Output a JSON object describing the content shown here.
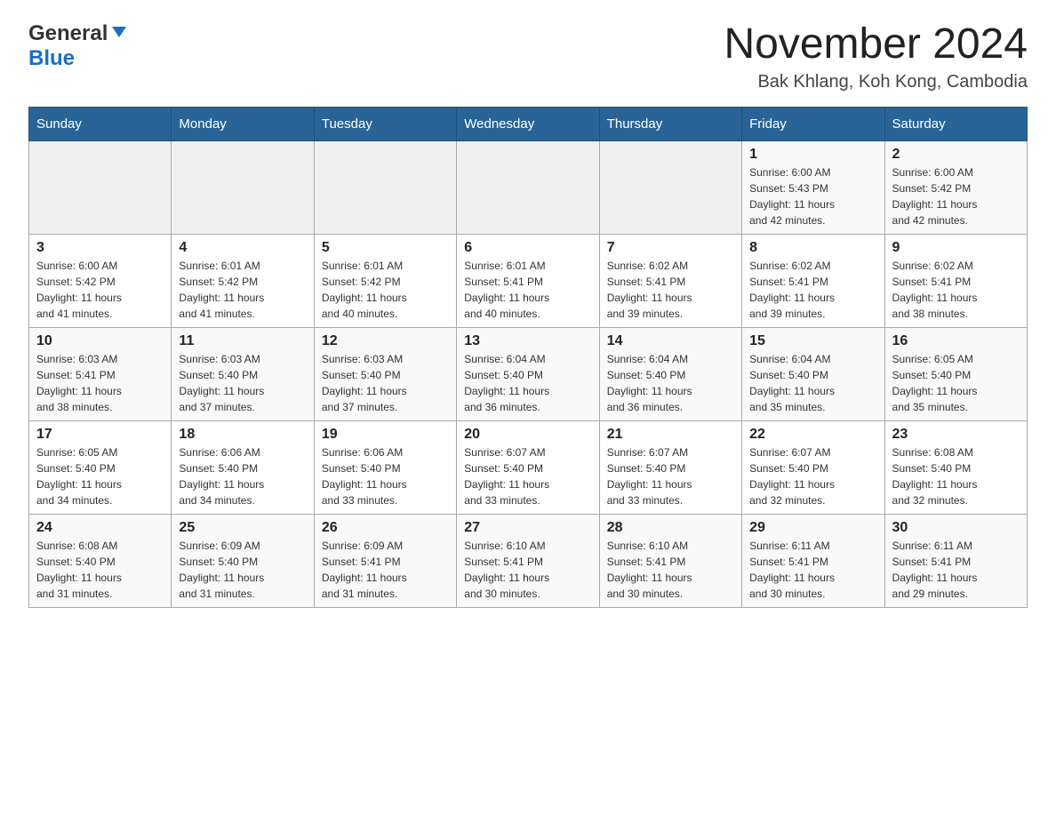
{
  "header": {
    "logo_general": "General",
    "logo_blue": "Blue",
    "month_title": "November 2024",
    "location": "Bak Khlang, Koh Kong, Cambodia"
  },
  "days_of_week": [
    "Sunday",
    "Monday",
    "Tuesday",
    "Wednesday",
    "Thursday",
    "Friday",
    "Saturday"
  ],
  "weeks": [
    [
      {
        "day": "",
        "info": ""
      },
      {
        "day": "",
        "info": ""
      },
      {
        "day": "",
        "info": ""
      },
      {
        "day": "",
        "info": ""
      },
      {
        "day": "",
        "info": ""
      },
      {
        "day": "1",
        "info": "Sunrise: 6:00 AM\nSunset: 5:43 PM\nDaylight: 11 hours\nand 42 minutes."
      },
      {
        "day": "2",
        "info": "Sunrise: 6:00 AM\nSunset: 5:42 PM\nDaylight: 11 hours\nand 42 minutes."
      }
    ],
    [
      {
        "day": "3",
        "info": "Sunrise: 6:00 AM\nSunset: 5:42 PM\nDaylight: 11 hours\nand 41 minutes."
      },
      {
        "day": "4",
        "info": "Sunrise: 6:01 AM\nSunset: 5:42 PM\nDaylight: 11 hours\nand 41 minutes."
      },
      {
        "day": "5",
        "info": "Sunrise: 6:01 AM\nSunset: 5:42 PM\nDaylight: 11 hours\nand 40 minutes."
      },
      {
        "day": "6",
        "info": "Sunrise: 6:01 AM\nSunset: 5:41 PM\nDaylight: 11 hours\nand 40 minutes."
      },
      {
        "day": "7",
        "info": "Sunrise: 6:02 AM\nSunset: 5:41 PM\nDaylight: 11 hours\nand 39 minutes."
      },
      {
        "day": "8",
        "info": "Sunrise: 6:02 AM\nSunset: 5:41 PM\nDaylight: 11 hours\nand 39 minutes."
      },
      {
        "day": "9",
        "info": "Sunrise: 6:02 AM\nSunset: 5:41 PM\nDaylight: 11 hours\nand 38 minutes."
      }
    ],
    [
      {
        "day": "10",
        "info": "Sunrise: 6:03 AM\nSunset: 5:41 PM\nDaylight: 11 hours\nand 38 minutes."
      },
      {
        "day": "11",
        "info": "Sunrise: 6:03 AM\nSunset: 5:40 PM\nDaylight: 11 hours\nand 37 minutes."
      },
      {
        "day": "12",
        "info": "Sunrise: 6:03 AM\nSunset: 5:40 PM\nDaylight: 11 hours\nand 37 minutes."
      },
      {
        "day": "13",
        "info": "Sunrise: 6:04 AM\nSunset: 5:40 PM\nDaylight: 11 hours\nand 36 minutes."
      },
      {
        "day": "14",
        "info": "Sunrise: 6:04 AM\nSunset: 5:40 PM\nDaylight: 11 hours\nand 36 minutes."
      },
      {
        "day": "15",
        "info": "Sunrise: 6:04 AM\nSunset: 5:40 PM\nDaylight: 11 hours\nand 35 minutes."
      },
      {
        "day": "16",
        "info": "Sunrise: 6:05 AM\nSunset: 5:40 PM\nDaylight: 11 hours\nand 35 minutes."
      }
    ],
    [
      {
        "day": "17",
        "info": "Sunrise: 6:05 AM\nSunset: 5:40 PM\nDaylight: 11 hours\nand 34 minutes."
      },
      {
        "day": "18",
        "info": "Sunrise: 6:06 AM\nSunset: 5:40 PM\nDaylight: 11 hours\nand 34 minutes."
      },
      {
        "day": "19",
        "info": "Sunrise: 6:06 AM\nSunset: 5:40 PM\nDaylight: 11 hours\nand 33 minutes."
      },
      {
        "day": "20",
        "info": "Sunrise: 6:07 AM\nSunset: 5:40 PM\nDaylight: 11 hours\nand 33 minutes."
      },
      {
        "day": "21",
        "info": "Sunrise: 6:07 AM\nSunset: 5:40 PM\nDaylight: 11 hours\nand 33 minutes."
      },
      {
        "day": "22",
        "info": "Sunrise: 6:07 AM\nSunset: 5:40 PM\nDaylight: 11 hours\nand 32 minutes."
      },
      {
        "day": "23",
        "info": "Sunrise: 6:08 AM\nSunset: 5:40 PM\nDaylight: 11 hours\nand 32 minutes."
      }
    ],
    [
      {
        "day": "24",
        "info": "Sunrise: 6:08 AM\nSunset: 5:40 PM\nDaylight: 11 hours\nand 31 minutes."
      },
      {
        "day": "25",
        "info": "Sunrise: 6:09 AM\nSunset: 5:40 PM\nDaylight: 11 hours\nand 31 minutes."
      },
      {
        "day": "26",
        "info": "Sunrise: 6:09 AM\nSunset: 5:41 PM\nDaylight: 11 hours\nand 31 minutes."
      },
      {
        "day": "27",
        "info": "Sunrise: 6:10 AM\nSunset: 5:41 PM\nDaylight: 11 hours\nand 30 minutes."
      },
      {
        "day": "28",
        "info": "Sunrise: 6:10 AM\nSunset: 5:41 PM\nDaylight: 11 hours\nand 30 minutes."
      },
      {
        "day": "29",
        "info": "Sunrise: 6:11 AM\nSunset: 5:41 PM\nDaylight: 11 hours\nand 30 minutes."
      },
      {
        "day": "30",
        "info": "Sunrise: 6:11 AM\nSunset: 5:41 PM\nDaylight: 11 hours\nand 29 minutes."
      }
    ]
  ],
  "colors": {
    "header_bg": "#2a6496",
    "header_text": "#ffffff",
    "accent_blue": "#1a6fc4"
  }
}
